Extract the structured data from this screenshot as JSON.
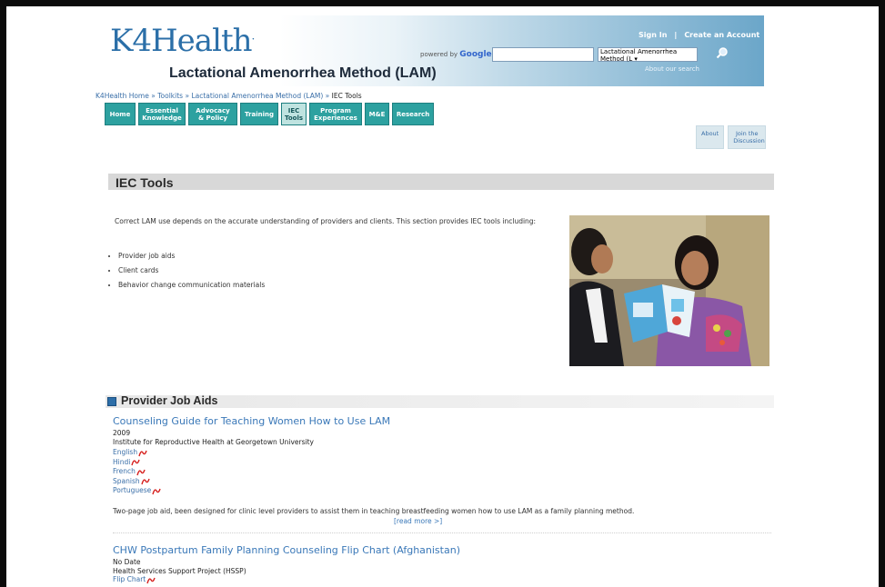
{
  "header": {
    "logo_text": "K4Health",
    "logo_mark": ".",
    "toolkit_title": "Lactational Amenorrhea Method (LAM)",
    "powered_by": "powered by",
    "google": "Google",
    "search_placeholder": "",
    "search_scope": "Lactational Amenorrhea Method (L",
    "about_search": "About our search",
    "sign_in": "Sign In",
    "separator": "|",
    "create_account": "Create an Account"
  },
  "breadcrumb": {
    "items": [
      "K4Health Home",
      "Toolkits",
      "Lactational Amenorrhea Method (LAM)"
    ],
    "sep": "»",
    "current": "IEC Tools"
  },
  "nav": {
    "tabs": [
      {
        "label": "Home"
      },
      {
        "label": "Essential Knowledge"
      },
      {
        "label": "Advocacy & Policy"
      },
      {
        "label": "Training"
      },
      {
        "label": "IEC Tools"
      },
      {
        "label": "Program Experiences"
      },
      {
        "label": "M&E"
      },
      {
        "label": "Research"
      }
    ]
  },
  "side_buttons": {
    "about": "About",
    "join": "Join the Discussion"
  },
  "main": {
    "section_title": "IEC Tools",
    "intro": "Correct LAM use depends on the accurate understanding of providers and clients. This section provides IEC tools including:",
    "bullets": [
      "Provider job aids",
      "Client cards",
      "Behavior change communication materials"
    ]
  },
  "job_aids": {
    "heading": "Provider Job Aids",
    "item1": {
      "title": "Counseling Guide for Teaching Women How to Use LAM",
      "year": "2009",
      "org": "Institute for Reproductive Health at Georgetown University",
      "links": [
        "English",
        "Hindi",
        "French",
        "Spanish",
        "Portuguese"
      ],
      "description": "Two-page job aid, been designed for clinic level providers to assist them in teaching breastfeeding women how to use LAM as a family planning method.",
      "read_more": "[read more >]"
    },
    "item2": {
      "title": "CHW Postpartum Family Planning Counseling Flip Chart (Afghanistan)",
      "year": "No Date",
      "org": "Health Services Support Project (HSSP)",
      "links": [
        "Flip Chart"
      ]
    }
  },
  "colors": {
    "tab": "#2da1a0",
    "link": "#3a78b8",
    "header_blue": "#6ba6c9"
  }
}
